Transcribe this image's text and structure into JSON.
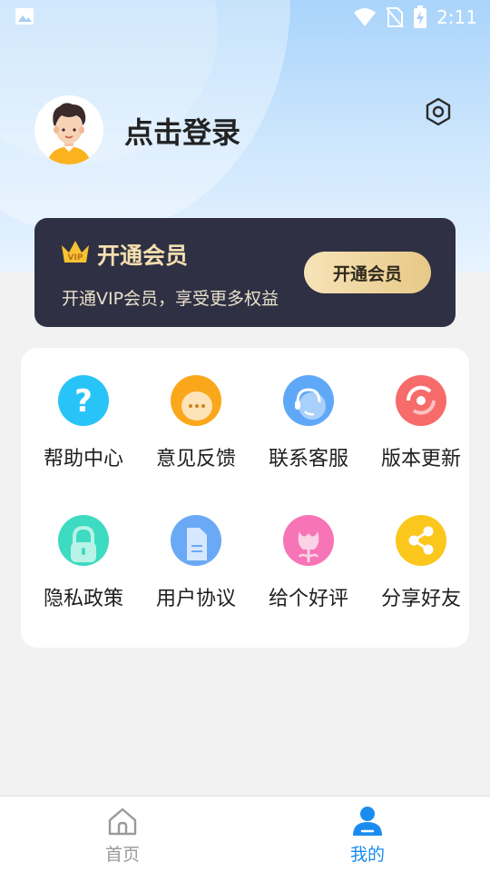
{
  "status_bar": {
    "time": "2:11",
    "left_icon": "gallery-icon",
    "right_icons": [
      "wifi-icon",
      "no-sim-icon",
      "battery-charging-icon"
    ]
  },
  "profile": {
    "avatar_icon": "avatar-cartoon-icon",
    "login_label": "点击登录",
    "settings_icon": "settings-hexagon-icon"
  },
  "vip": {
    "icon": "vip-crown-icon",
    "title": "开通会员",
    "subtitle": "开通VIP会员，享受更多权益",
    "button_label": "开通会员",
    "card_color": "#2f3043",
    "accent": "#f4dfb0"
  },
  "menu": [
    {
      "label": "帮助中心",
      "icon": "help-icon",
      "color": "#29c4f7"
    },
    {
      "label": "意见反馈",
      "icon": "feedback-icon",
      "color": "#fba71b"
    },
    {
      "label": "联系客服",
      "icon": "customer-service-icon",
      "color": "#5fa8f7"
    },
    {
      "label": "版本更新",
      "icon": "version-update-icon",
      "color": "#f76b6b"
    },
    {
      "label": "隐私政策",
      "icon": "privacy-lock-icon",
      "color": "#3ddbc1"
    },
    {
      "label": "用户协议",
      "icon": "user-agreement-icon",
      "color": "#6aa9f5"
    },
    {
      "label": "给个好评",
      "icon": "rate-flower-icon",
      "color": "#f774b6"
    },
    {
      "label": "分享好友",
      "icon": "share-icon",
      "color": "#fcc71c"
    }
  ],
  "bottom_nav": {
    "items": [
      {
        "label": "首页",
        "icon": "home-icon",
        "active": false
      },
      {
        "label": "我的",
        "icon": "profile-icon",
        "active": true
      }
    ],
    "active_color": "#1a8cf0",
    "inactive_color": "#9a9a9a"
  }
}
